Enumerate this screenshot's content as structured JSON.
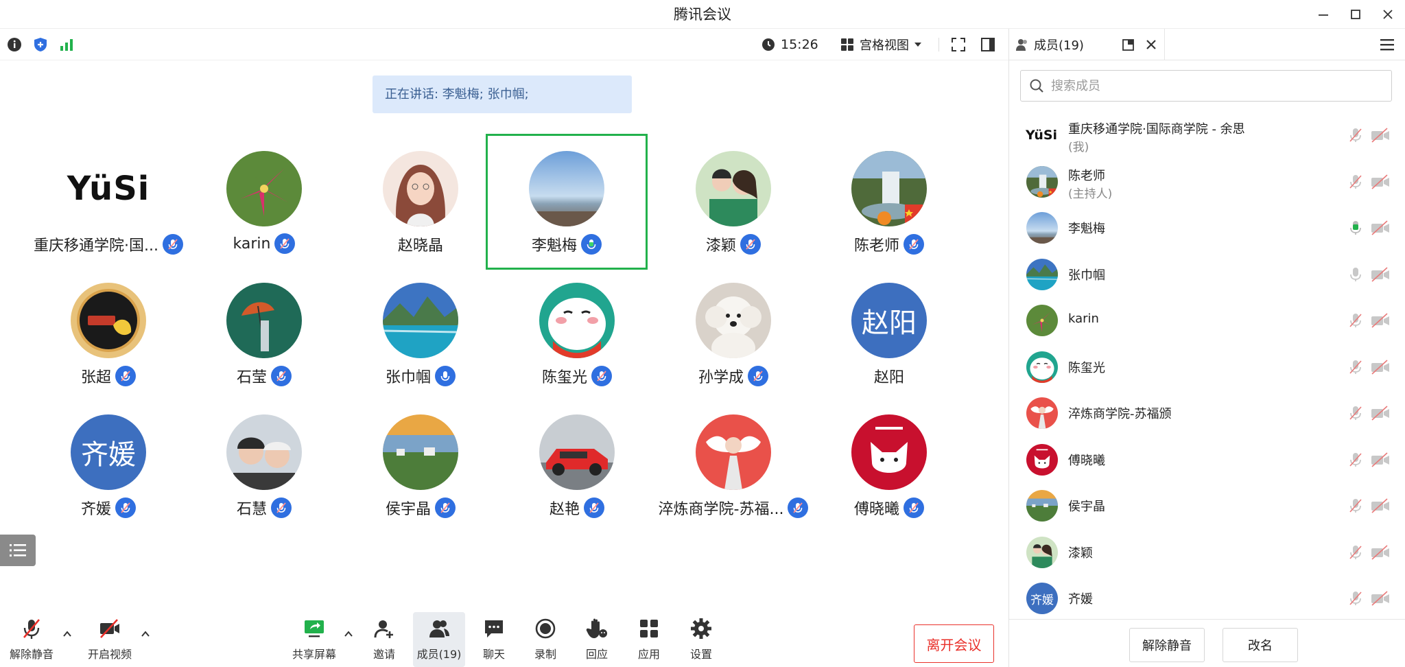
{
  "window": {
    "title": "腾讯会议"
  },
  "topbar": {
    "time": "15:26",
    "view_label": "宫格视图"
  },
  "speaking_banner": "正在讲话: 李魁梅; 张巾帼;",
  "grid": [
    {
      "name": "重庆移通学院·国...",
      "avatar": "logo",
      "avatar_text": "YüSi",
      "mic": "muted"
    },
    {
      "name": "karin",
      "avatar": "photo-lily",
      "mic": "muted"
    },
    {
      "name": "赵晓晶",
      "avatar": "photo-girl-drawing",
      "mic": "none"
    },
    {
      "name": "李魁梅",
      "avatar": "photo-sea",
      "mic": "speaking",
      "active": true
    },
    {
      "name": "漆颖",
      "avatar": "photo-two-girls",
      "mic": "muted"
    },
    {
      "name": "陈老师",
      "avatar": "photo-waterfall",
      "mic": "muted"
    },
    {
      "name": "张超",
      "avatar": "photo-badge",
      "mic": "muted"
    },
    {
      "name": "石莹",
      "avatar": "photo-umbrella",
      "mic": "muted"
    },
    {
      "name": "张巾帼",
      "avatar": "photo-lake",
      "mic": "on"
    },
    {
      "name": "陈玺光",
      "avatar": "photo-rabbit",
      "mic": "muted"
    },
    {
      "name": "孙学成",
      "avatar": "photo-dog",
      "mic": "muted"
    },
    {
      "name": "赵阳",
      "avatar": "text",
      "avatar_text": "赵阳",
      "mic": "none"
    },
    {
      "name": "齐媛",
      "avatar": "text",
      "avatar_text": "齐媛",
      "mic": "muted"
    },
    {
      "name": "石慧",
      "avatar": "photo-couple",
      "mic": "muted"
    },
    {
      "name": "侯宇晶",
      "avatar": "photo-sunset",
      "mic": "muted"
    },
    {
      "name": "赵艳",
      "avatar": "photo-car",
      "mic": "muted"
    },
    {
      "name": "淬炼商学院-苏福...",
      "avatar": "photo-angel",
      "mic": "muted"
    },
    {
      "name": "傅晓曦",
      "avatar": "photo-cat-red",
      "mic": "muted"
    }
  ],
  "toolbar": {
    "unmute": "解除静音",
    "start_video": "开启视频",
    "share_screen": "共享屏幕",
    "invite": "邀请",
    "members": "成员(19)",
    "chat": "聊天",
    "record": "录制",
    "reaction": "回应",
    "apps": "应用",
    "settings": "设置",
    "leave": "离开会议"
  },
  "panel": {
    "tab_label": "成员(19)",
    "search_placeholder": "搜索成员",
    "members": [
      {
        "name": "重庆移通学院·国际商学院 - 余思",
        "sub": "(我)",
        "avatar": "logo",
        "avatar_text": "YüSi",
        "mic": "muted"
      },
      {
        "name": "陈老师",
        "sub": "(主持人)",
        "avatar": "photo-waterfall",
        "mic": "muted"
      },
      {
        "name": "李魁梅",
        "sub": "",
        "avatar": "photo-sea",
        "mic": "speaking"
      },
      {
        "name": "张巾帼",
        "sub": "",
        "avatar": "photo-lake",
        "mic": "on"
      },
      {
        "name": "karin",
        "sub": "",
        "avatar": "photo-lily",
        "mic": "muted"
      },
      {
        "name": "陈玺光",
        "sub": "",
        "avatar": "photo-rabbit",
        "mic": "muted"
      },
      {
        "name": "淬炼商学院-苏福颁",
        "sub": "",
        "avatar": "photo-angel",
        "mic": "muted"
      },
      {
        "name": "傅晓曦",
        "sub": "",
        "avatar": "photo-cat-red",
        "mic": "muted"
      },
      {
        "name": "侯宇晶",
        "sub": "",
        "avatar": "photo-sunset",
        "mic": "muted"
      },
      {
        "name": "漆颖",
        "sub": "",
        "avatar": "photo-two-girls",
        "mic": "muted"
      },
      {
        "name": "齐媛",
        "sub": "",
        "avatar": "text",
        "avatar_text": "齐媛",
        "mic": "muted"
      }
    ],
    "unmute_button": "解除静音",
    "rename_button": "改名"
  },
  "colors": {
    "accent_blue": "#2f6fe0",
    "speaking_green": "#22b14c",
    "leave_red": "#e9302a",
    "banner_bg": "#dce9fb",
    "text_avatar_bg": "#3d6fbf"
  }
}
